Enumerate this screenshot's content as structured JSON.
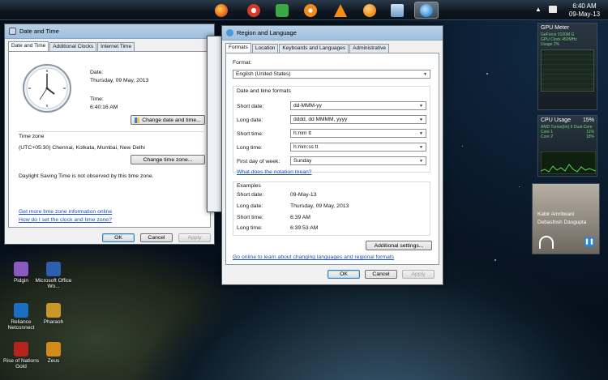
{
  "taskbar": {
    "apps": [
      {
        "icon": "firefox-icon",
        "color": "#e66a1f"
      },
      {
        "icon": "ccleaner-icon",
        "color": "#d33a2a"
      },
      {
        "icon": "download-manager-icon",
        "color": "#3aa847"
      },
      {
        "icon": "avast-icon",
        "color": "#f08a1c"
      },
      {
        "icon": "vlc-icon",
        "color": "#f28c12"
      },
      {
        "icon": "orange-ball-icon",
        "color": "#f0901c"
      },
      {
        "icon": "control-panel-icon",
        "color": "#8fb6d9"
      },
      {
        "icon": "region-globe-icon",
        "color": "#4a9ad8"
      }
    ],
    "clock_time": "6:40 AM",
    "clock_date": "09-May-13"
  },
  "date_time_window": {
    "title": "Date and Time",
    "tabs": [
      "Date and Time",
      "Additional Clocks",
      "Internet Time"
    ],
    "date_label": "Date:",
    "date_value": "Thursday, 09 May, 2013",
    "time_label": "Time:",
    "time_value": "6:40:16 AM",
    "change_date_button": "Change date and time...",
    "time_zone_heading": "Time zone",
    "time_zone_value": "(UTC+05:30) Chennai, Kolkata, Mumbai, New Delhi",
    "change_zone_button": "Change time zone...",
    "dst_note": "Daylight Saving Time is not observed by this time zone.",
    "link_more_info": "Get more time zone information online",
    "link_how_set": "How do I set the clock and time zone?",
    "ok": "OK",
    "cancel": "Cancel",
    "apply": "Apply"
  },
  "region_window": {
    "title": "Region and Language",
    "tabs": [
      "Formats",
      "Location",
      "Keyboards and Languages",
      "Administrative"
    ],
    "format_label": "Format:",
    "format_value": "English (United States)",
    "group_title": "Date and time formats",
    "fields": [
      {
        "label": "Short date:",
        "value": "dd-MMM-yy"
      },
      {
        "label": "Long date:",
        "value": "dddd, dd MMMM, yyyy"
      },
      {
        "label": "Short time:",
        "value": "h:mm tt"
      },
      {
        "label": "Long time:",
        "value": "h:mm:ss tt"
      },
      {
        "label": "First day of week:",
        "value": "Sunday"
      }
    ],
    "notation_link": "What does the notation mean?",
    "examples_title": "Examples",
    "examples": [
      {
        "label": "Short date:",
        "value": "09-May-13"
      },
      {
        "label": "Long date:",
        "value": "Thursday, 09 May, 2013"
      },
      {
        "label": "Short time:",
        "value": "6:39 AM"
      },
      {
        "label": "Long time:",
        "value": "6:39:53 AM"
      }
    ],
    "additional_settings": "Additional settings...",
    "online_link": "Go online to learn about changing languages and regional formats",
    "ok": "OK",
    "cancel": "Cancel",
    "apply": "Apply"
  },
  "gadgets": {
    "gpu_title": "GPU Meter",
    "gpu_model": "GeForce 9100M G",
    "gpu_usage": "Usage 2%",
    "gpu_clock": "GPU Clock 450MHz",
    "cpu_title": "CPU Usage",
    "cpu_percent": "15%",
    "cpu_detail": "AMD Turion(tm) II Dual-Core",
    "cpu_core1": "Core 1",
    "cpu_core1_val": "11%",
    "cpu_core2": "Core 2",
    "cpu_core2_val": "18%",
    "media_artist": "Kabir Amritwani",
    "media_subtitle": "Debashish Dasgupta"
  },
  "desktop_icons": [
    {
      "label": "Pidgin",
      "icon": "pidgin-icon",
      "color": "#8a5ac0"
    },
    {
      "label": "Microsoft Office Wo...",
      "icon": "word-icon",
      "color": "#2e5fae"
    },
    {
      "label": "Reliance Netconnect",
      "icon": "reliance-icon",
      "color": "#1a6fc4"
    },
    {
      "label": "Pharaoh",
      "icon": "pharaoh-icon",
      "color": "#c9962a"
    },
    {
      "label": "Rise of Nations Gold",
      "icon": "rise-of-nations-icon",
      "color": "#b3241c"
    },
    {
      "label": "Zeus",
      "icon": "zeus-icon",
      "color": "#d28a1a"
    }
  ]
}
